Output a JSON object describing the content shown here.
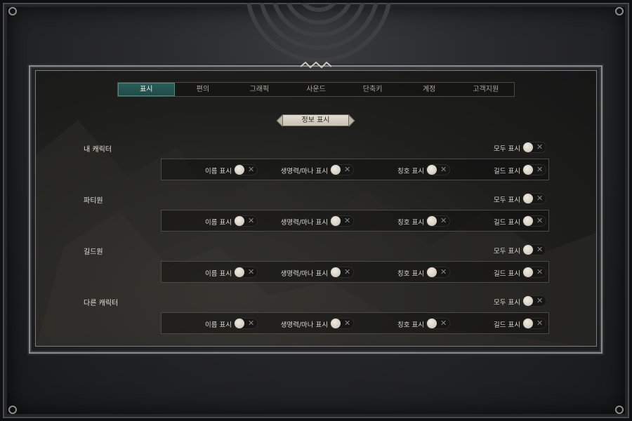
{
  "tabs": [
    {
      "label": "표시",
      "active": true
    },
    {
      "label": "편의",
      "active": false
    },
    {
      "label": "그래픽",
      "active": false
    },
    {
      "label": "사운드",
      "active": false
    },
    {
      "label": "단축키",
      "active": false
    },
    {
      "label": "계정",
      "active": false
    },
    {
      "label": "고객지원",
      "active": false
    }
  ],
  "section_title": "정보 표시",
  "show_all_label": "모두 표시",
  "option_labels": {
    "name": "이름 표시",
    "hp_mana": "생명력/마나 표시",
    "title": "칭호 표시",
    "guild": "길드 표시"
  },
  "groups": [
    {
      "label": "내 캐릭터",
      "show_all": false,
      "name": false,
      "hp_mana": false,
      "title": false,
      "guild": false
    },
    {
      "label": "파티원",
      "show_all": false,
      "name": false,
      "hp_mana": false,
      "title": false,
      "guild": false
    },
    {
      "label": "길드원",
      "show_all": false,
      "name": false,
      "hp_mana": false,
      "title": false,
      "guild": false
    },
    {
      "label": "다른 캐릭터",
      "show_all": false,
      "name": false,
      "hp_mana": false,
      "title": false,
      "guild": false
    }
  ],
  "toggle_off_glyph": "✕",
  "colors": {
    "accent": "#1f4a46",
    "knob": "#e3ddd0"
  }
}
